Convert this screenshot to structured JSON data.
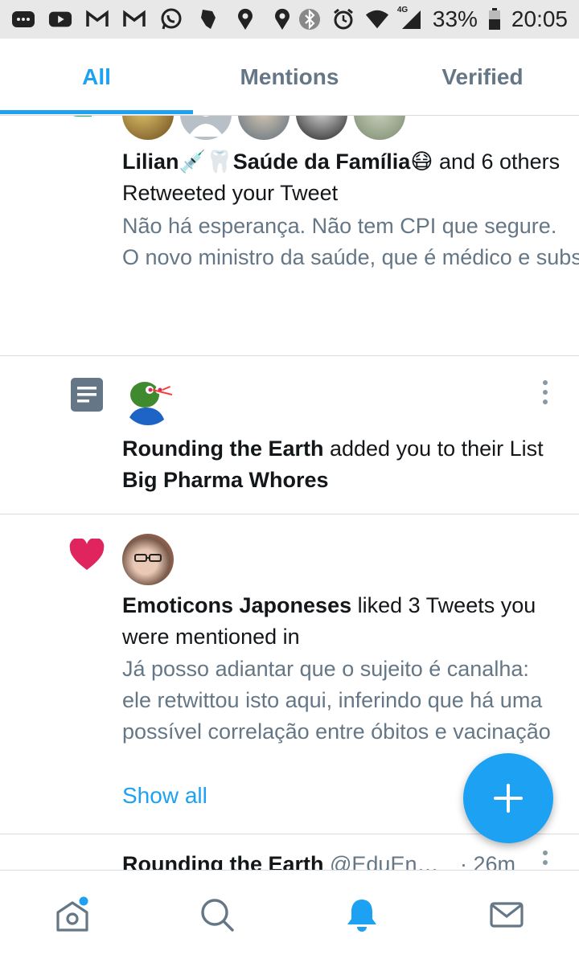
{
  "status_bar": {
    "battery_percent": "33%",
    "time": "20:05",
    "network": "4G",
    "left_icons": [
      "messages-icon",
      "youtube-icon",
      "gmail-icon",
      "gmail-icon",
      "whatsapp-icon",
      "map-app-icon",
      "location-pin-icon",
      "location-pin-icon"
    ],
    "right_icons": [
      "bluetooth-icon",
      "alarm-icon",
      "wifi-icon",
      "signal-icon",
      "battery-icon"
    ]
  },
  "tabs": [
    {
      "label": "All",
      "active": true
    },
    {
      "label": "Mentions",
      "active": false
    },
    {
      "label": "Verified",
      "active": false
    }
  ],
  "notifications": [
    {
      "type": "retweet",
      "icon": "retweet-icon",
      "actor": "Lilian💉🦷Saúde da Família😷",
      "action": " and 6 others Retweeted your Tweet",
      "preview_line1": "Não há esperança. Não tem CPI que segure.",
      "preview_line2": "O novo ministro da saúde, que é médico e substituiu o milico de funesta…"
    },
    {
      "type": "list",
      "icon": "list-icon",
      "actor": "Rounding the Earth",
      "action_mid": " added you to their List ",
      "list_name": "Big Pharma Whores"
    },
    {
      "type": "like",
      "icon": "heart-icon",
      "actor": "Emoticons Japoneses",
      "action": " liked 3 Tweets you were mentioned in",
      "preview": "Já posso adiantar que o sujeito é canalha: ele retwittou isto aqui, inferindo que há uma possível correlação entre óbitos e vacinação em Gibraltar. D…",
      "show_all": "Show all"
    },
    {
      "type": "tweet",
      "actor": "Rounding the Earth",
      "handle": "@EduEn…",
      "time": "· 26m"
    }
  ],
  "bottom_nav": [
    "home-icon",
    "search-icon",
    "notifications-icon",
    "messages-icon"
  ],
  "colors": {
    "accent": "#1da1f2",
    "retweet": "#17bf63",
    "like": "#e0245e",
    "secondary_text": "#657786"
  }
}
